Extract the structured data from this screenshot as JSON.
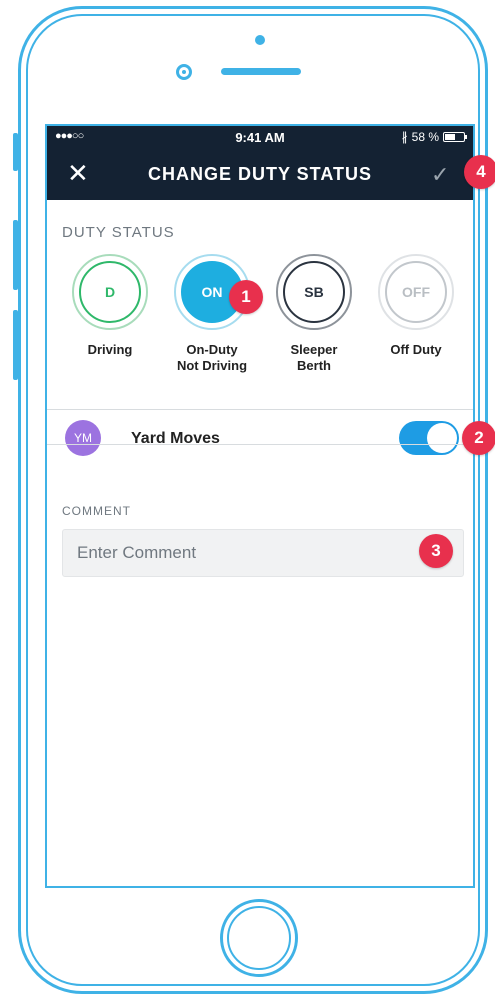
{
  "statusbar": {
    "signal": "●●●○○",
    "time": "9:41 AM",
    "bluetooth": "∦",
    "battery_text": "58 %",
    "battery_level": 0.58
  },
  "navbar": {
    "close_icon": "close-icon",
    "title": "CHANGE DUTY STATUS",
    "confirm_icon": "check-icon"
  },
  "duty_status": {
    "label": "DUTY STATUS",
    "options": [
      {
        "code": "D",
        "label": "Driving",
        "color": "#2fb86a",
        "selected": false
      },
      {
        "code": "ON",
        "label": "On-Duty\nNot Driving",
        "color": "#1eaee0",
        "selected": true
      },
      {
        "code": "SB",
        "label": "Sleeper\nBerth",
        "color": "#2b3440",
        "selected": false
      },
      {
        "code": "OFF",
        "label": "Off Duty",
        "color": "#b9bec3",
        "selected": false
      }
    ]
  },
  "yard_moves": {
    "avatar": "YM",
    "label": "Yard Moves",
    "enabled": true
  },
  "comment": {
    "label": "COMMENT",
    "placeholder": "Enter Comment",
    "value": ""
  },
  "markers": [
    "1",
    "2",
    "3",
    "4"
  ],
  "colors": {
    "frame": "#3fb2e6",
    "navbar": "#142233",
    "accent": "#1e9ce4",
    "marker": "#e8304d",
    "avatar": "#9c73e0"
  }
}
